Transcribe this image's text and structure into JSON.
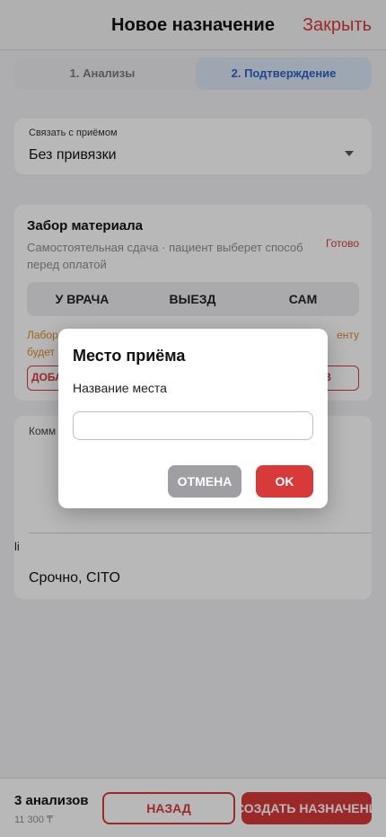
{
  "header": {
    "title": "Новое назначение",
    "close_label": "Закрыть"
  },
  "steps": {
    "step1": "1. Анализы",
    "step2": "2. Подтверждение"
  },
  "link": {
    "label": "Связать с приёмом",
    "value": "Без привязки"
  },
  "pickup": {
    "title": "Забор материала",
    "description": "Самостоятельная сдача · пациент выберет способ перед оплатой",
    "status": "Готово",
    "options": [
      "У ВРАЧА",
      "ВЫЕЗД",
      "САМ"
    ],
    "note_line1": "Лабор",
    "note_line1_end": "енту",
    "note_line2": "будет",
    "add_left": "ДОБА",
    "add_right": "В"
  },
  "comment": {
    "label": "Комм",
    "cursor_text": "li",
    "urgency": "Срочно, CITO"
  },
  "footer": {
    "count": "3 анализов",
    "price": "11 300 ₸",
    "back_label": "НАЗАД",
    "create_label": "СОЗДАТЬ НАЗНАЧЕНИЕ"
  },
  "dialog": {
    "title": "Место приёма",
    "field_label": "Название места",
    "input_value": "",
    "cancel_label": "ОТМЕНА",
    "ok_label": "OK"
  }
}
